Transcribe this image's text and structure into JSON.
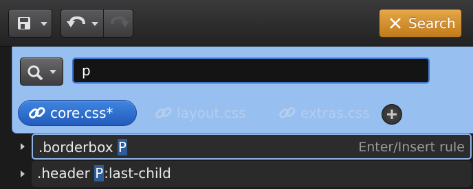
{
  "toolbar": {
    "save_icon": "save-icon",
    "undo_icon": "undo-icon",
    "redo_icon": "redo-icon",
    "search_label": "Search",
    "search_color": "#d99a35"
  },
  "panel": {
    "query_value": "p",
    "scope_icon": "magnifier-icon",
    "accent_color": "#97bff0",
    "tabs": [
      {
        "label": "core.css*",
        "active": true
      },
      {
        "label": "layout.css",
        "active": false
      },
      {
        "label": "extras.css",
        "active": false
      }
    ],
    "add_icon": "add-icon"
  },
  "results": [
    {
      "prefix": ".borderbox ",
      "match": "P",
      "suffix": "",
      "hint": "Enter/Insert rule"
    },
    {
      "prefix": ".header ",
      "match": "P",
      "suffix": ":last-child",
      "hint": ""
    }
  ]
}
